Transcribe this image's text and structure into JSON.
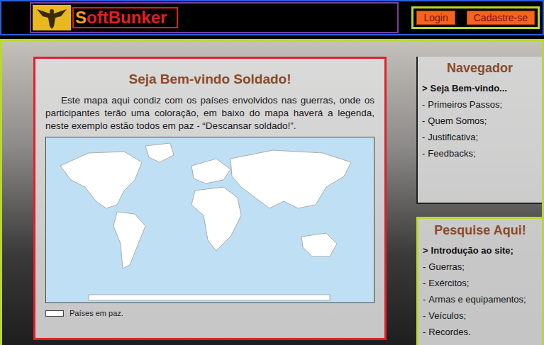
{
  "header": {
    "logo": "SoftBunker",
    "buttons": [
      "Login",
      "Cadastre-se"
    ]
  },
  "welcome": {
    "title": "Seja Bem-vindo Soldado!",
    "text": "Este mapa aqui condiz com os países envolvidos nas guerras, onde os participantes terão uma coloração, em baixo do mapa haverá a legenda, neste exemplo estão todos em paz - “Descansar soldado!”.",
    "legend": [
      {
        "label": "Países em paz.",
        "color": "#ffffff"
      }
    ]
  },
  "navigator": {
    "title": "Navegador",
    "items": [
      {
        "marker": ">",
        "label": "Seja Bem-vindo...",
        "selected": true
      },
      {
        "marker": "-",
        "label": "Primeiros Passos;",
        "selected": false
      },
      {
        "marker": "-",
        "label": "Quem Somos;",
        "selected": false
      },
      {
        "marker": "-",
        "label": "Justificativa;",
        "selected": false
      },
      {
        "marker": "-",
        "label": "Feedbacks;",
        "selected": false
      }
    ]
  },
  "search": {
    "title": "Pesquise Aqui!",
    "items": [
      {
        "marker": ">",
        "label": "Introdução ao site;",
        "selected": true
      },
      {
        "marker": "-",
        "label": "Guerras;",
        "selected": false
      },
      {
        "marker": "-",
        "label": "Exércitos;",
        "selected": false
      },
      {
        "marker": "-",
        "label": "Armas e equipamentos;",
        "selected": false
      },
      {
        "marker": "-",
        "label": "Veículos;",
        "selected": false
      },
      {
        "marker": "-",
        "label": "Recordes.",
        "selected": false
      }
    ]
  }
}
